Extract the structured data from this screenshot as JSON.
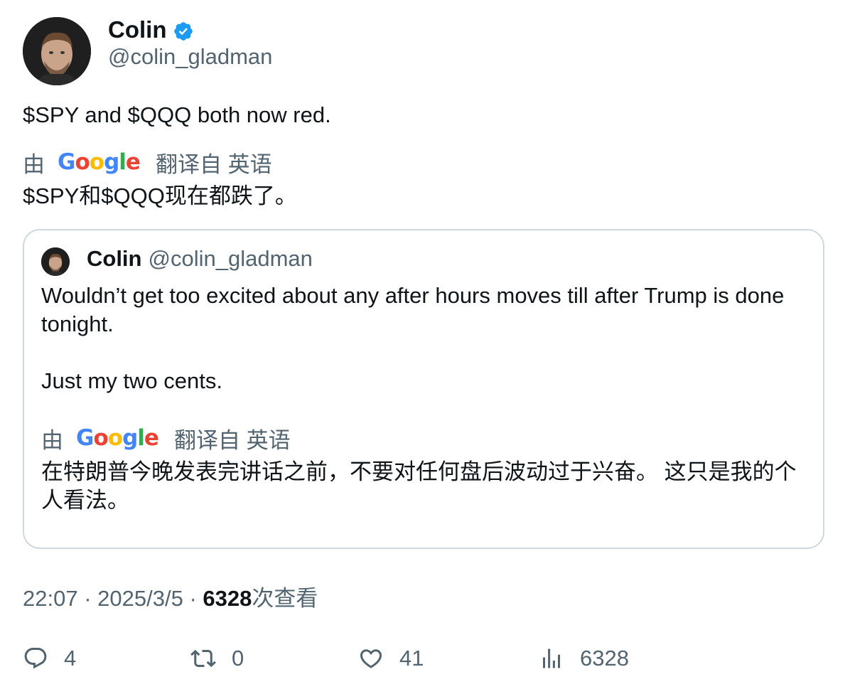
{
  "tweet": {
    "author_name": "Colin",
    "author_handle": "@colin_gladman",
    "text": "$SPY and $QQQ both now red.",
    "translation": {
      "by_label": "由",
      "provider": "Google",
      "translated_from_label": "翻译自 英语",
      "text": "$SPY和$QQQ现在都跌了。"
    },
    "meta": {
      "time": "22:07",
      "separator": "·",
      "date": "2025/3/5",
      "views_count": "6328",
      "views_label": "次查看"
    },
    "actions": {
      "replies": "4",
      "retweets": "0",
      "likes": "41",
      "views": "6328"
    }
  },
  "quoted_tweet": {
    "author_name": "Colin",
    "author_handle": "@colin_gladman",
    "text_line1": "Wouldn’t get too excited about any after hours moves till after Trump is done tonight.",
    "text_line2": "Just my two cents.",
    "translation": {
      "by_label": "由",
      "provider": "Google",
      "translated_from_label": "翻译自 英语",
      "text": "在特朗普今晚发表完讲话之前，不要对任何盘后波动过于兴奋。 这只是我的个人看法。"
    }
  },
  "colors": {
    "verified": "#1d9bf0",
    "secondary_text": "#536471",
    "primary_text": "#0f1419",
    "border": "#cfd9de"
  },
  "icons": [
    "verified-badge-icon",
    "reply-icon",
    "retweet-icon",
    "like-icon",
    "views-icon"
  ]
}
